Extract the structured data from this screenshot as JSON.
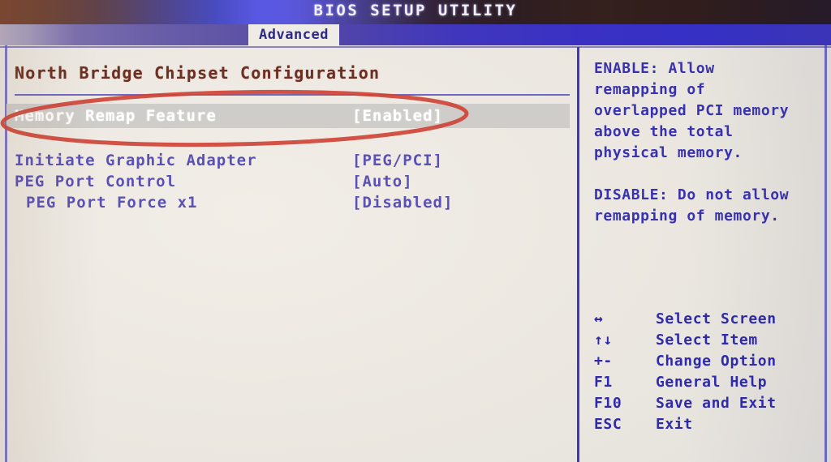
{
  "window": {
    "title": "BIOS SETUP UTILITY"
  },
  "tabs": [
    {
      "label": "Advanced",
      "active": true
    }
  ],
  "main": {
    "section_title": "North Bridge Chipset Configuration",
    "settings": [
      {
        "label": "Memory Remap Feature",
        "value": "[Enabled]",
        "selected": true,
        "indent": false
      },
      {
        "label": "Initiate Graphic Adapter",
        "value": "[PEG/PCI]",
        "selected": false,
        "indent": false
      },
      {
        "label": "PEG Port Control",
        "value": "[Auto]",
        "selected": false,
        "indent": false
      },
      {
        "label": "PEG Port Force x1",
        "value": "[Disabled]",
        "selected": false,
        "indent": true
      }
    ]
  },
  "help": {
    "text": "ENABLE: Allow\nremapping of\noverlapped PCI memory\nabove the total\nphysical memory.\n\nDISABLE: Do not allow\nremapping of memory."
  },
  "legend": [
    {
      "key": "↔",
      "desc": "Select Screen"
    },
    {
      "key": "↑↓",
      "desc": "Select Item"
    },
    {
      "key": "+-",
      "desc": "Change Option"
    },
    {
      "key": "F1",
      "desc": "General Help"
    },
    {
      "key": "F10",
      "desc": "Save and Exit"
    },
    {
      "key": "ESC",
      "desc": "Exit"
    }
  ],
  "annotation": {
    "shape": "ellipse",
    "target": "Memory Remap Feature",
    "color": "#cf4437"
  },
  "colors": {
    "background": "#efebe4",
    "text_blue": "#5b51b5",
    "section_title": "#6b3023",
    "selected_bg": "#cfcdca",
    "selected_text": "#ffffff",
    "tab_bar": "#3b34bd",
    "annotation_red": "#cf4437"
  }
}
